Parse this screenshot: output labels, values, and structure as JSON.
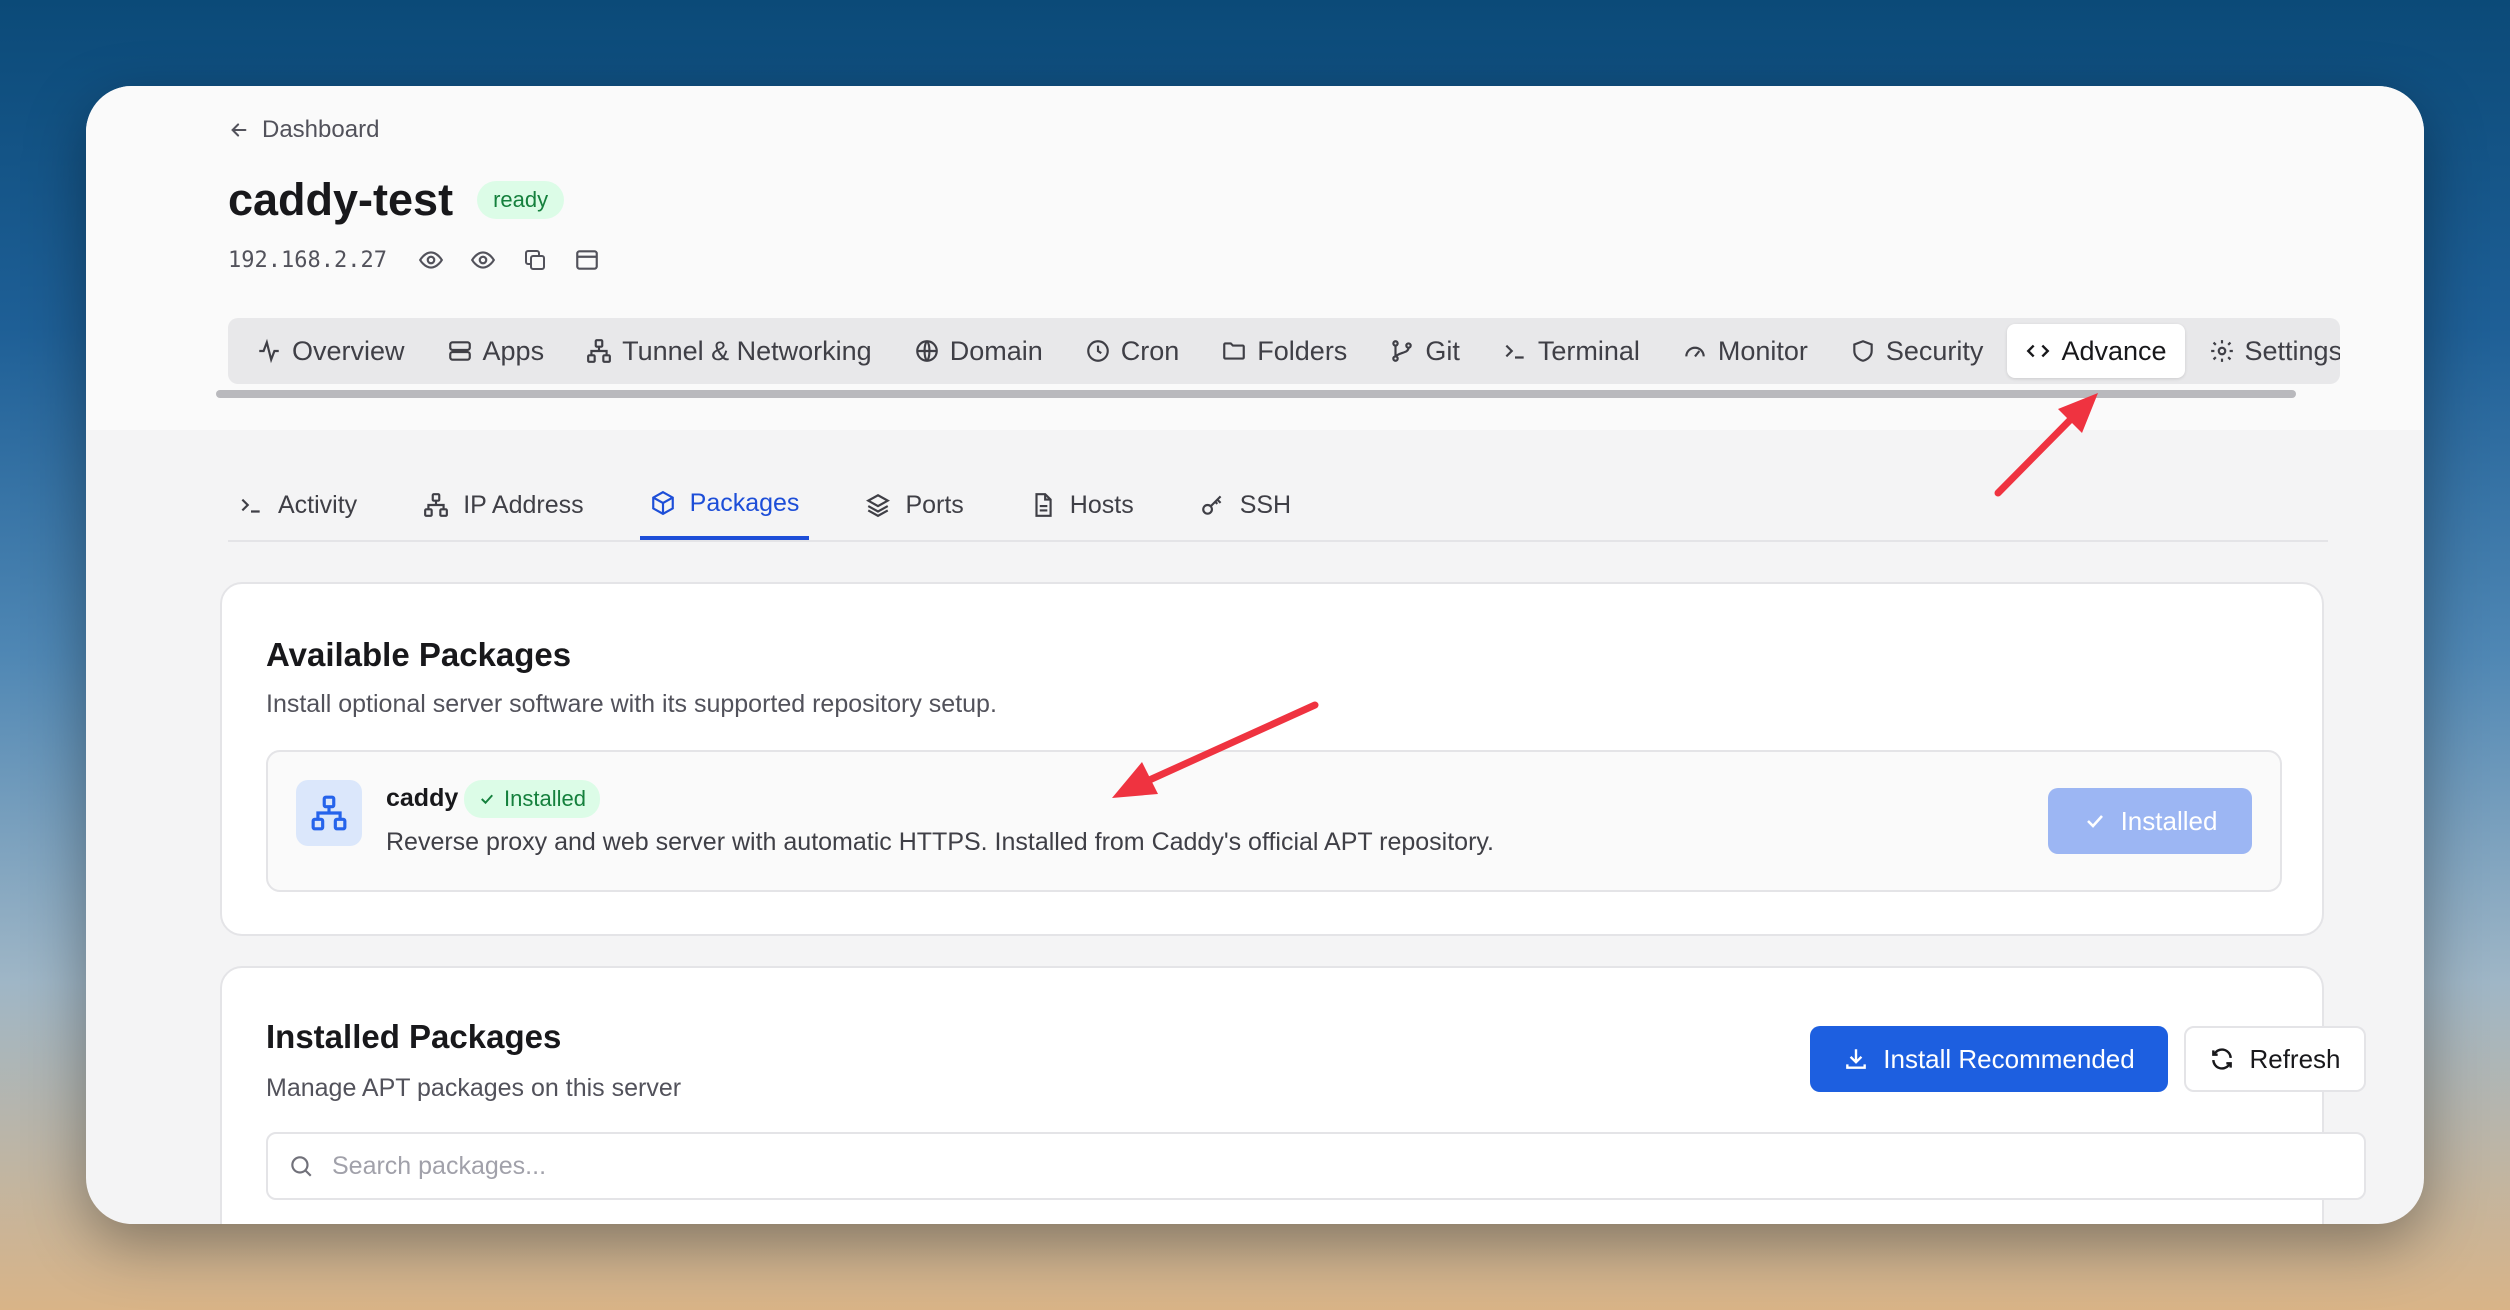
{
  "breadcrumb": {
    "back_label": "Dashboard"
  },
  "server": {
    "name": "caddy-test",
    "status": "ready",
    "ip": "192.168.2.27"
  },
  "tabs": [
    {
      "label": "Overview",
      "icon": "activity-icon"
    },
    {
      "label": "Apps",
      "icon": "server-stack-icon"
    },
    {
      "label": "Tunnel & Networking",
      "icon": "network-icon"
    },
    {
      "label": "Domain",
      "icon": "globe-icon"
    },
    {
      "label": "Cron",
      "icon": "clock-icon"
    },
    {
      "label": "Folders",
      "icon": "folder-icon"
    },
    {
      "label": "Git",
      "icon": "git-branch-icon"
    },
    {
      "label": "Terminal",
      "icon": "terminal-icon"
    },
    {
      "label": "Monitor",
      "icon": "gauge-icon"
    },
    {
      "label": "Security",
      "icon": "shield-icon"
    },
    {
      "label": "Advance",
      "icon": "code-icon",
      "active": true
    },
    {
      "label": "Settings",
      "icon": "gear-icon"
    }
  ],
  "subtabs": [
    {
      "label": "Activity",
      "icon": "terminal-icon"
    },
    {
      "label": "IP Address",
      "icon": "network-icon"
    },
    {
      "label": "Packages",
      "icon": "package-icon",
      "active": true
    },
    {
      "label": "Ports",
      "icon": "layers-icon"
    },
    {
      "label": "Hosts",
      "icon": "file-icon"
    },
    {
      "label": "SSH",
      "icon": "key-icon"
    }
  ],
  "available": {
    "title": "Available Packages",
    "subtitle": "Install optional server software with its supported repository setup.",
    "package": {
      "name": "caddy",
      "badge": "Installed",
      "description": "Reverse proxy and web server with automatic HTTPS. Installed from Caddy's official APT repository.",
      "button": "Installed"
    }
  },
  "installed": {
    "title": "Installed Packages",
    "subtitle": "Manage APT packages on this server",
    "install_button": "Install Recommended",
    "refresh_button": "Refresh",
    "search_placeholder": "Search packages..."
  },
  "colors": {
    "accent": "#1d5fe0",
    "success": "#15803d",
    "annotation": "#ef3340"
  }
}
